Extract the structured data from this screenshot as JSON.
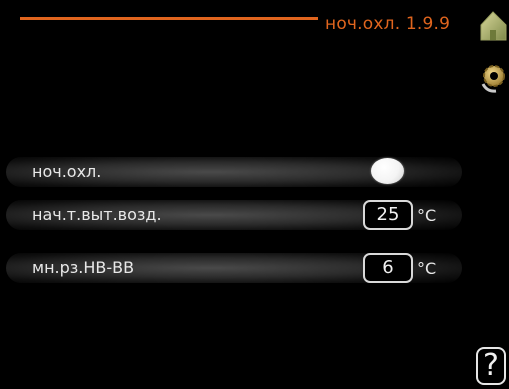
{
  "header": {
    "title": "ноч.охл. 1.9.9",
    "accent_color": "#e0651e",
    "home_icon": "home-icon",
    "settings_icon": "settings-icon"
  },
  "rows": [
    {
      "label": "ноч.охл.",
      "control": "toggle",
      "state": "on"
    },
    {
      "label": "нач.т.выт.возд.",
      "value": "25",
      "unit": "°C"
    },
    {
      "label": "мн.рз.НВ-ВВ",
      "value": "6",
      "unit": "°C"
    }
  ],
  "help": {
    "label": "?"
  }
}
